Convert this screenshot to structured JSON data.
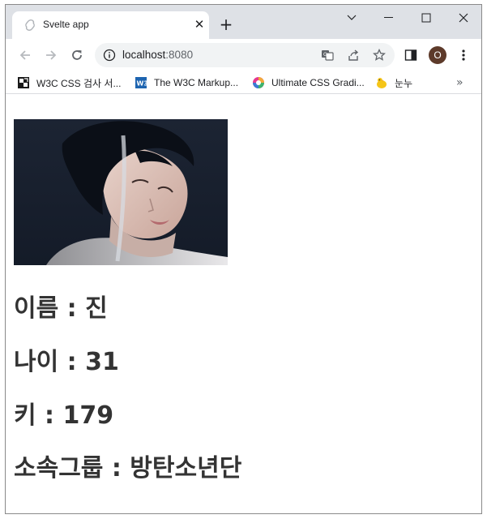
{
  "browser": {
    "tab_title": "Svelte app",
    "tab_close": "✕",
    "new_tab": "+",
    "url_host": "localhost",
    "url_port": ":8080",
    "bookmarks": [
      {
        "label": "W3C CSS 검사 서...",
        "icon": "w3c-css-icon"
      },
      {
        "label": "The W3C Markup...",
        "icon": "w3c-icon"
      },
      {
        "label": "Ultimate CSS Gradi...",
        "icon": "gradient-icon"
      },
      {
        "label": "눈누",
        "icon": "noonnu-icon"
      }
    ],
    "bookmarks_more": "»",
    "profile_initial": "O",
    "profile_color": "#5d3a2a"
  },
  "profile": {
    "name_label": "이름",
    "name_value": "진",
    "age_label": "나이",
    "age_value": "31",
    "height_label": "키",
    "height_value": "179",
    "group_label": "소속그룹",
    "group_value": "방탄소년단",
    "separator": " : "
  }
}
